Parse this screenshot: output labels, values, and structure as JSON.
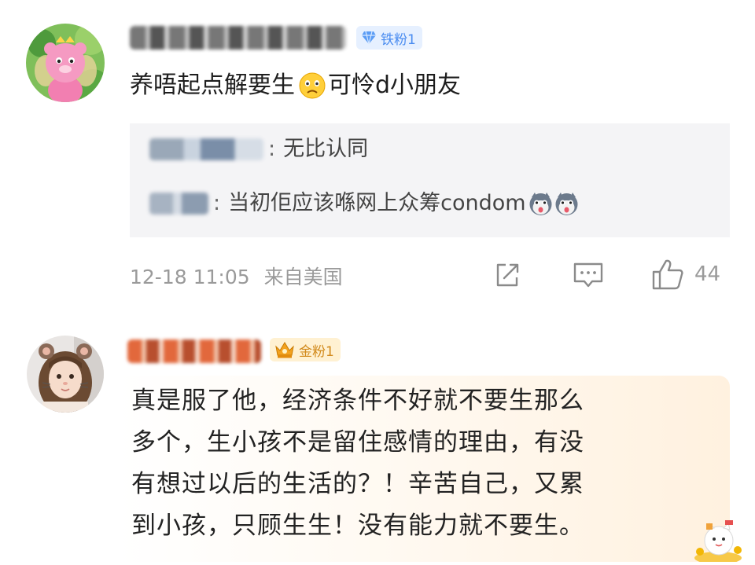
{
  "comments": [
    {
      "badge": "铁粉1",
      "text": "养唔起点解要生",
      "text_after_emoji": " 可怜d小朋友",
      "replies": [
        {
          "text": "无比认同"
        },
        {
          "text": "当初佢应该喺网上众筹condom"
        }
      ],
      "timestamp": "12-18 11:05",
      "location": "来自美国",
      "like_count": "44"
    },
    {
      "badge": "金粉1",
      "text_lines": [
        "真是服了他，经济条件不好就不要生那么",
        "多个，生小孩不是留住感情的理由，有没",
        "有想过以后的生活的？！辛苦自己，又累",
        "到小孩，只顾生生！没有能力就不要生。"
      ]
    }
  ],
  "icons": {
    "share": "share-icon",
    "comment": "comment-icon",
    "like": "thumb-up-icon",
    "badge_iron": "diamond-icon",
    "badge_gold": "crown-icon",
    "sad_emoji": "sad-face-emoji-icon",
    "husky_emoji": "husky-emoji-icon",
    "sticker": "lucky-cat-sticker-icon"
  },
  "colors": {
    "iron_badge_bg": "#e6f0ff",
    "iron_badge_text": "#4a8cf0",
    "gold_badge_bg": "#fff1d2",
    "gold_badge_text": "#d28a1c",
    "reply_bg": "#f4f4f6",
    "meta_text": "#9a9a9a"
  }
}
